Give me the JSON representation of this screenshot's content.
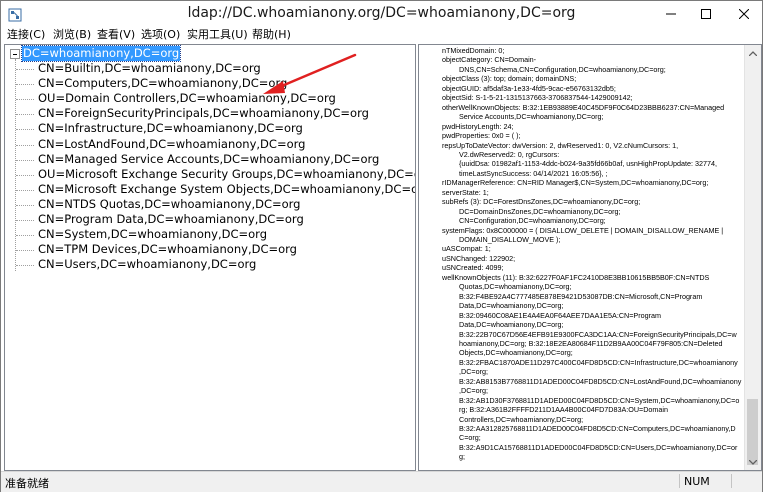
{
  "window": {
    "title": "ldap://DC.whoamianony.org/DC=whoamianony,DC=org",
    "minimize_label": "—",
    "maximize_label": "☐",
    "close_label": "✕"
  },
  "menu": [
    "连接(C)",
    "浏览(B)",
    "查看(V)",
    "选项(O)",
    "实用工具(U)",
    "帮助(H)"
  ],
  "tree": {
    "root": "DC=whoamianony,DC=org",
    "children": [
      "CN=Builtin,DC=whoamianony,DC=org",
      "CN=Computers,DC=whoamianony,DC=org",
      "OU=Domain Controllers,DC=whoamianony,DC=org",
      "CN=ForeignSecurityPrincipals,DC=whoamianony,DC=org",
      "CN=Infrastructure,DC=whoamianony,DC=org",
      "CN=LostAndFound,DC=whoamianony,DC=org",
      "CN=Managed Service Accounts,DC=whoamianony,DC=org",
      "OU=Microsoft Exchange Security Groups,DC=whoamianony,DC=org",
      "CN=Microsoft Exchange System Objects,DC=whoamianony,DC=org",
      "CN=NTDS Quotas,DC=whoamianony,DC=org",
      "CN=Program Data,DC=whoamianony,DC=org",
      "CN=System,DC=whoamianony,DC=org",
      "CN=TPM Devices,DC=whoamianony,DC=org",
      "CN=Users,DC=whoamianony,DC=org"
    ]
  },
  "details": [
    {
      "text": "nTMixedDomain: 0;",
      "indent": 0
    },
    {
      "text": "objectCategory: CN=Domain-",
      "indent": 0
    },
    {
      "text": "DNS,CN=Schema,CN=Configuration,DC=whoamianony,DC=org;",
      "indent": 1
    },
    {
      "text": "objectClass (3): top; domain; domainDNS;",
      "indent": 0
    },
    {
      "text": "objectGUID: af5daf3a-1e33-4fd5-9cac-e56763132db5;",
      "indent": 0
    },
    {
      "text": "objectSid: S-1-5-21-1315137663-3706837544-1429009142;",
      "indent": 0
    },
    {
      "text": "otherWellKnownObjects: B:32:1EB93889E40C45DF9F0C64D23BBB6237:CN=Managed",
      "indent": 0
    },
    {
      "text": "Service Accounts,DC=whoamianony,DC=org;",
      "indent": 1
    },
    {
      "text": "pwdHistoryLength: 24;",
      "indent": 0
    },
    {
      "text": "pwdProperties: 0x0 = ( );",
      "indent": 0
    },
    {
      "text": "repsUpToDateVector: dwVersion: 2, dwReserved1: 0, V2.cNumCursors: 1,",
      "indent": 0
    },
    {
      "text": "V2.dwReserved2: 0, rgCursors:",
      "indent": 1
    },
    {
      "text": "{uuidDsa: 01982af1-1153-4ddc-b024-9a35fd66b0af, usnHighPropUpdate: 32774,",
      "indent": 1
    },
    {
      "text": "timeLastSyncSuccess: 04/14/2021 16:05:56}, ;",
      "indent": 1
    },
    {
      "text": "rIDManagerReference: CN=RID Manager$,CN=System,DC=whoamianony,DC=org;",
      "indent": 0
    },
    {
      "text": "serverState: 1;",
      "indent": 0
    },
    {
      "text": "subRefs (3): DC=ForestDnsZones,DC=whoamianony,DC=org;",
      "indent": 0
    },
    {
      "text": "DC=DomainDnsZones,DC=whoamianony,DC=org;",
      "indent": 1
    },
    {
      "text": "CN=Configuration,DC=whoamianony,DC=org;",
      "indent": 1
    },
    {
      "text": "systemFlags: 0x8C000000 = ( DISALLOW_DELETE | DOMAIN_DISALLOW_RENAME |",
      "indent": 0
    },
    {
      "text": "DOMAIN_DISALLOW_MOVE );",
      "indent": 1
    },
    {
      "text": "uASCompat: 1;",
      "indent": 0
    },
    {
      "text": "uSNChanged: 122902;",
      "indent": 0
    },
    {
      "text": "uSNCreated: 4099;",
      "indent": 0
    },
    {
      "text": "wellKnownObjects (11): B:32:6227F0AF1FC2410D8E3BB10615BB5B0F:CN=NTDS",
      "indent": 0
    },
    {
      "text": "Quotas,DC=whoamianony,DC=org;",
      "indent": 1
    },
    {
      "text": "B:32:F4BE92A4C777485E878E9421D53087DB:CN=Microsoft,CN=Program",
      "indent": 1
    },
    {
      "text": "Data,DC=whoamianony,DC=org;",
      "indent": 1
    },
    {
      "text": "B:32:09460C08AE1E4A4EA0F64AEE7DAA1E5A:CN=Program",
      "indent": 1
    },
    {
      "text": "Data,DC=whoamianony,DC=org;",
      "indent": 1
    },
    {
      "text": "B:32:22B70C67D56E4EFB91E9300FCA3DC1AA:CN=ForeignSecurityPrincipals,DC=w",
      "indent": 1
    },
    {
      "text": "hoamianony,DC=org; B:32:18E2EA80684F11D2B9AA00C04F79F805:CN=Deleted",
      "indent": 1
    },
    {
      "text": "Objects,DC=whoamianony,DC=org;",
      "indent": 1
    },
    {
      "text": "B:32:2FBAC1870ADE11D297C400C04FD8D5CD:CN=Infrastructure,DC=whoamianony",
      "indent": 1
    },
    {
      "text": ",DC=org;",
      "indent": 1
    },
    {
      "text": "B:32:AB8153B7768811D1ADED00C04FD8D5CD:CN=LostAndFound,DC=whoamianony",
      "indent": 1
    },
    {
      "text": ",DC=org;",
      "indent": 1
    },
    {
      "text": "B:32:AB1D30F3768811D1ADED00C04FD8D5CD:CN=System,DC=whoamianony,DC=o",
      "indent": 1
    },
    {
      "text": "rg; B:32:A361B2FFFFD211D1AA4B00C04FD7D83A:OU=Domain",
      "indent": 1
    },
    {
      "text": "Controllers,DC=whoamianony,DC=org;",
      "indent": 1
    },
    {
      "text": "B:32:AA312825768811D1ADED00C04FD8D5CD:CN=Computers,DC=whoamianony,D",
      "indent": 1
    },
    {
      "text": "C=org;",
      "indent": 1
    },
    {
      "text": "B:32:A9D1CA15768811D1ADED00C04FD8D5CD:CN=Users,DC=whoamianony,DC=or",
      "indent": 1
    },
    {
      "text": "g;",
      "indent": 1
    }
  ],
  "status": {
    "text": "准备就绪",
    "num": "NUM"
  }
}
